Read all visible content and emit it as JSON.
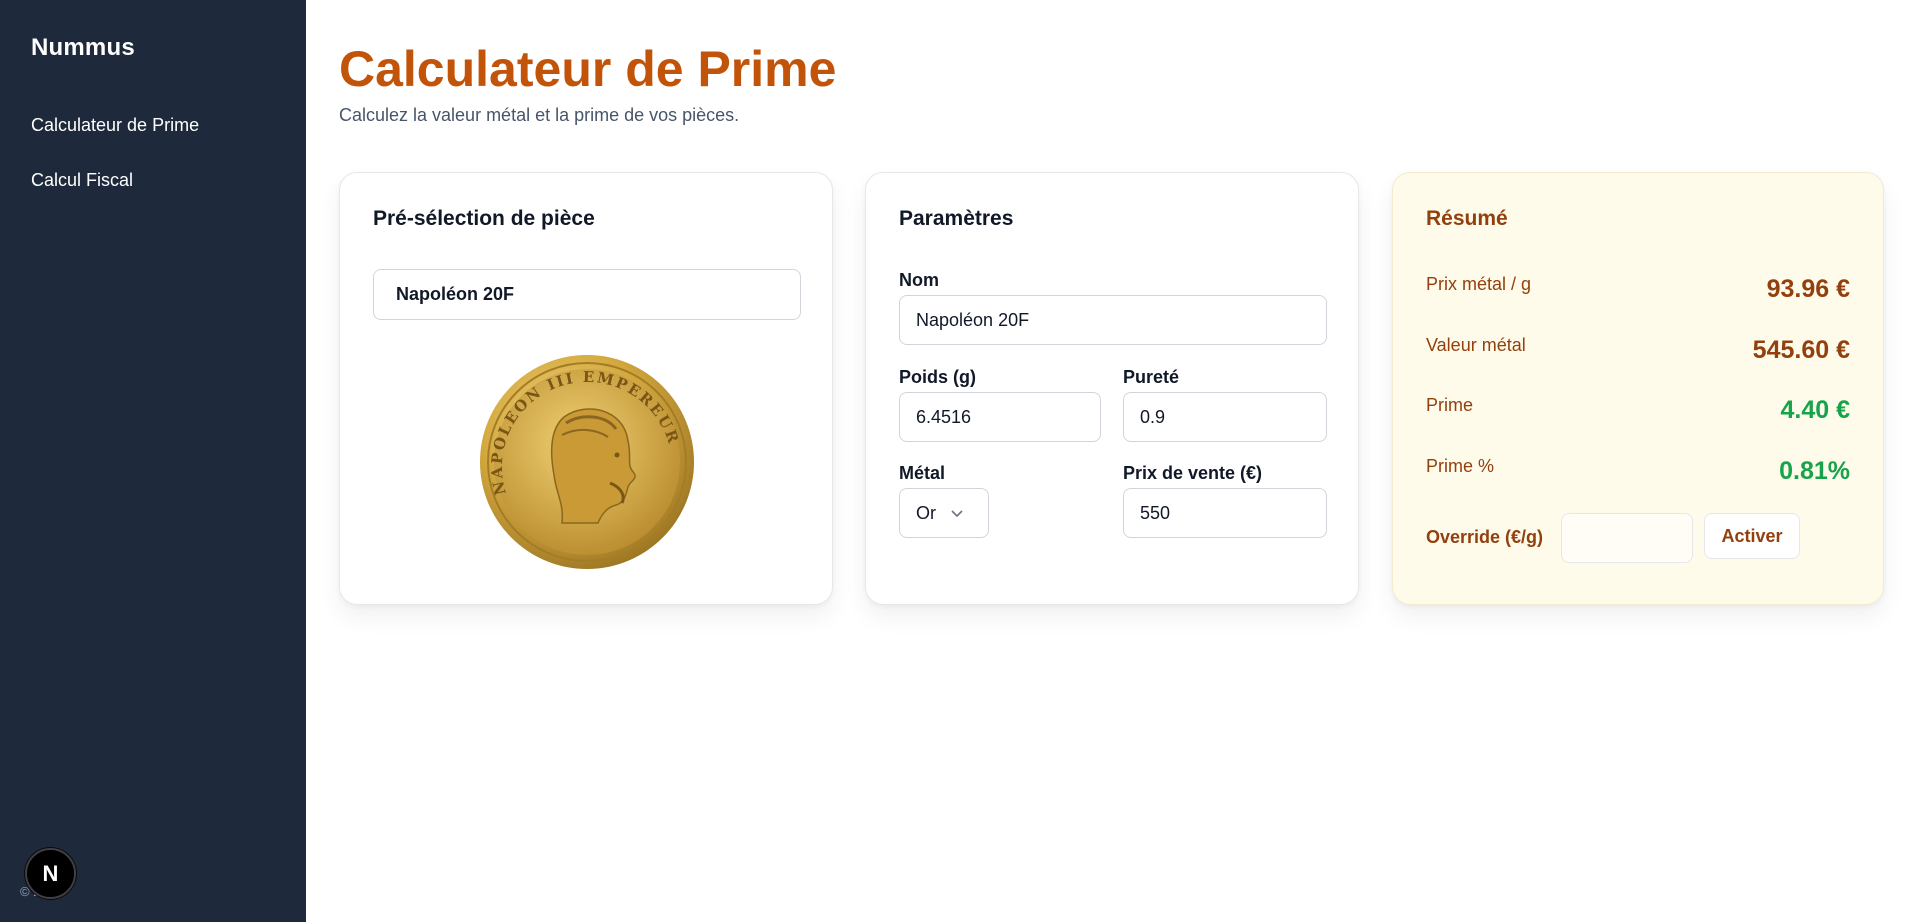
{
  "sidebar": {
    "brand": "Nummus",
    "items": [
      {
        "label": "Calculateur de Prime"
      },
      {
        "label": "Calcul Fiscal"
      }
    ],
    "footer": "© 2025",
    "badge_letter": "N"
  },
  "header": {
    "title": "Calculateur de Prime",
    "subtitle": "Calculez la valeur métal et la prime de vos pièces."
  },
  "preset": {
    "title": "Pré-sélection de pièce",
    "selected": "Napoléon 20F",
    "coin_inscription": "NAPOLEON III EMPEREUR"
  },
  "params": {
    "title": "Paramètres",
    "name_label": "Nom",
    "name_value": "Napoléon 20F",
    "weight_label": "Poids (g)",
    "weight_value": "6.4516",
    "purity_label": "Pureté",
    "purity_value": "0.9",
    "metal_label": "Métal",
    "metal_value": "Or",
    "price_label": "Prix de vente (€)",
    "price_value": "550"
  },
  "summary": {
    "title": "Résumé",
    "rows": [
      {
        "label": "Prix métal / g",
        "value": "93.96 €"
      },
      {
        "label": "Valeur métal",
        "value": "545.60 €"
      },
      {
        "label": "Prime",
        "value": "4.40 €"
      },
      {
        "label": "Prime %",
        "value": "0.81%"
      }
    ],
    "override_label": "Override (€/g)",
    "override_value": "",
    "activate_label": "Activer"
  },
  "colors": {
    "accent": "#c2540a",
    "sidebar_bg": "#1e293b",
    "summary_text": "#92400e",
    "positive": "#16a34a",
    "summary_bg": "#fefbeb"
  }
}
